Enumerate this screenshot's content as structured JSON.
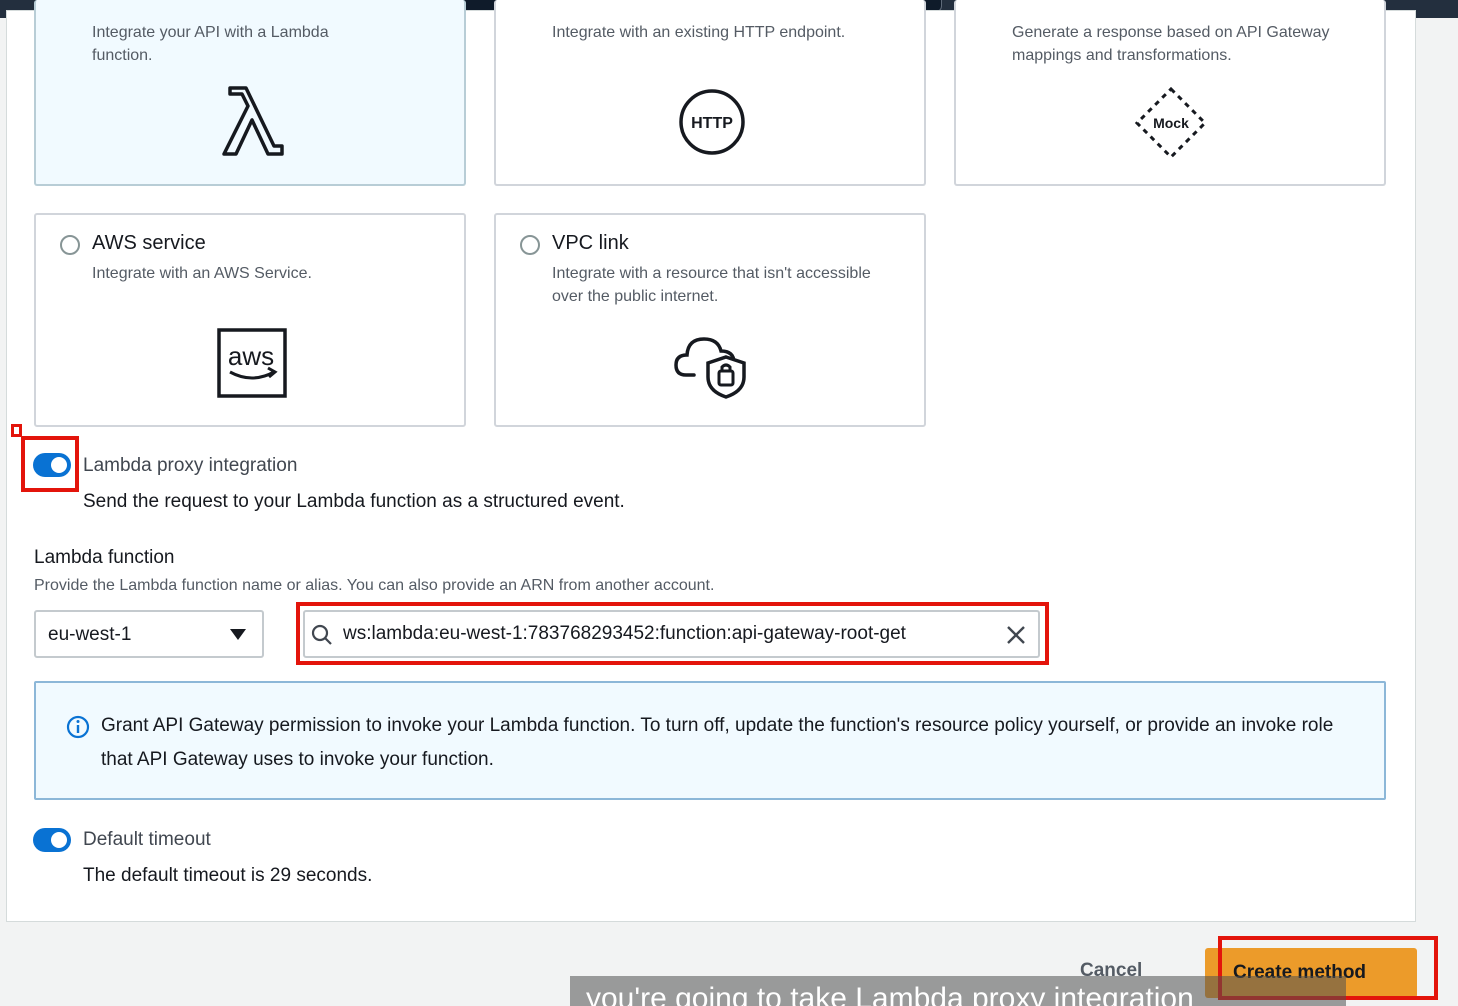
{
  "cards": {
    "lambda": {
      "desc": "Integrate your API with a Lambda function."
    },
    "http": {
      "desc": "Integrate with an existing HTTP endpoint.",
      "icon_text": "HTTP"
    },
    "mock": {
      "desc": "Generate a response based on API Gateway mappings and transformations.",
      "icon_text": "Mock"
    },
    "aws_service": {
      "title": "AWS service",
      "desc": "Integrate with an AWS Service.",
      "icon_text": "aws"
    },
    "vpc_link": {
      "title": "VPC link",
      "desc": "Integrate with a resource that isn't accessible over the public internet."
    }
  },
  "proxy_integration": {
    "label": "Lambda proxy integration",
    "description": "Send the request to your Lambda function as a structured event.",
    "enabled": true
  },
  "lambda_function": {
    "label": "Lambda function",
    "hint": "Provide the Lambda function name or alias. You can also provide an ARN from another account.",
    "region": "eu-west-1",
    "value": "ws:lambda:eu-west-1:783768293452:function:api-gateway-root-get"
  },
  "info": {
    "message": "Grant API Gateway permission to invoke your Lambda function. To turn off, update the function's resource policy yourself, or provide an invoke role that API Gateway uses to invoke your function."
  },
  "default_timeout": {
    "label": "Default timeout",
    "description": "The default timeout is 29 seconds.",
    "enabled": true
  },
  "actions": {
    "cancel": "Cancel",
    "create": "Create method"
  },
  "caption": "you're going to take Lambda proxy integration",
  "colors": {
    "toggle": "#0972d3",
    "primary_button": "#ec9b2a",
    "highlight": "#e3140b",
    "selected_card_bg": "#f1faff"
  }
}
